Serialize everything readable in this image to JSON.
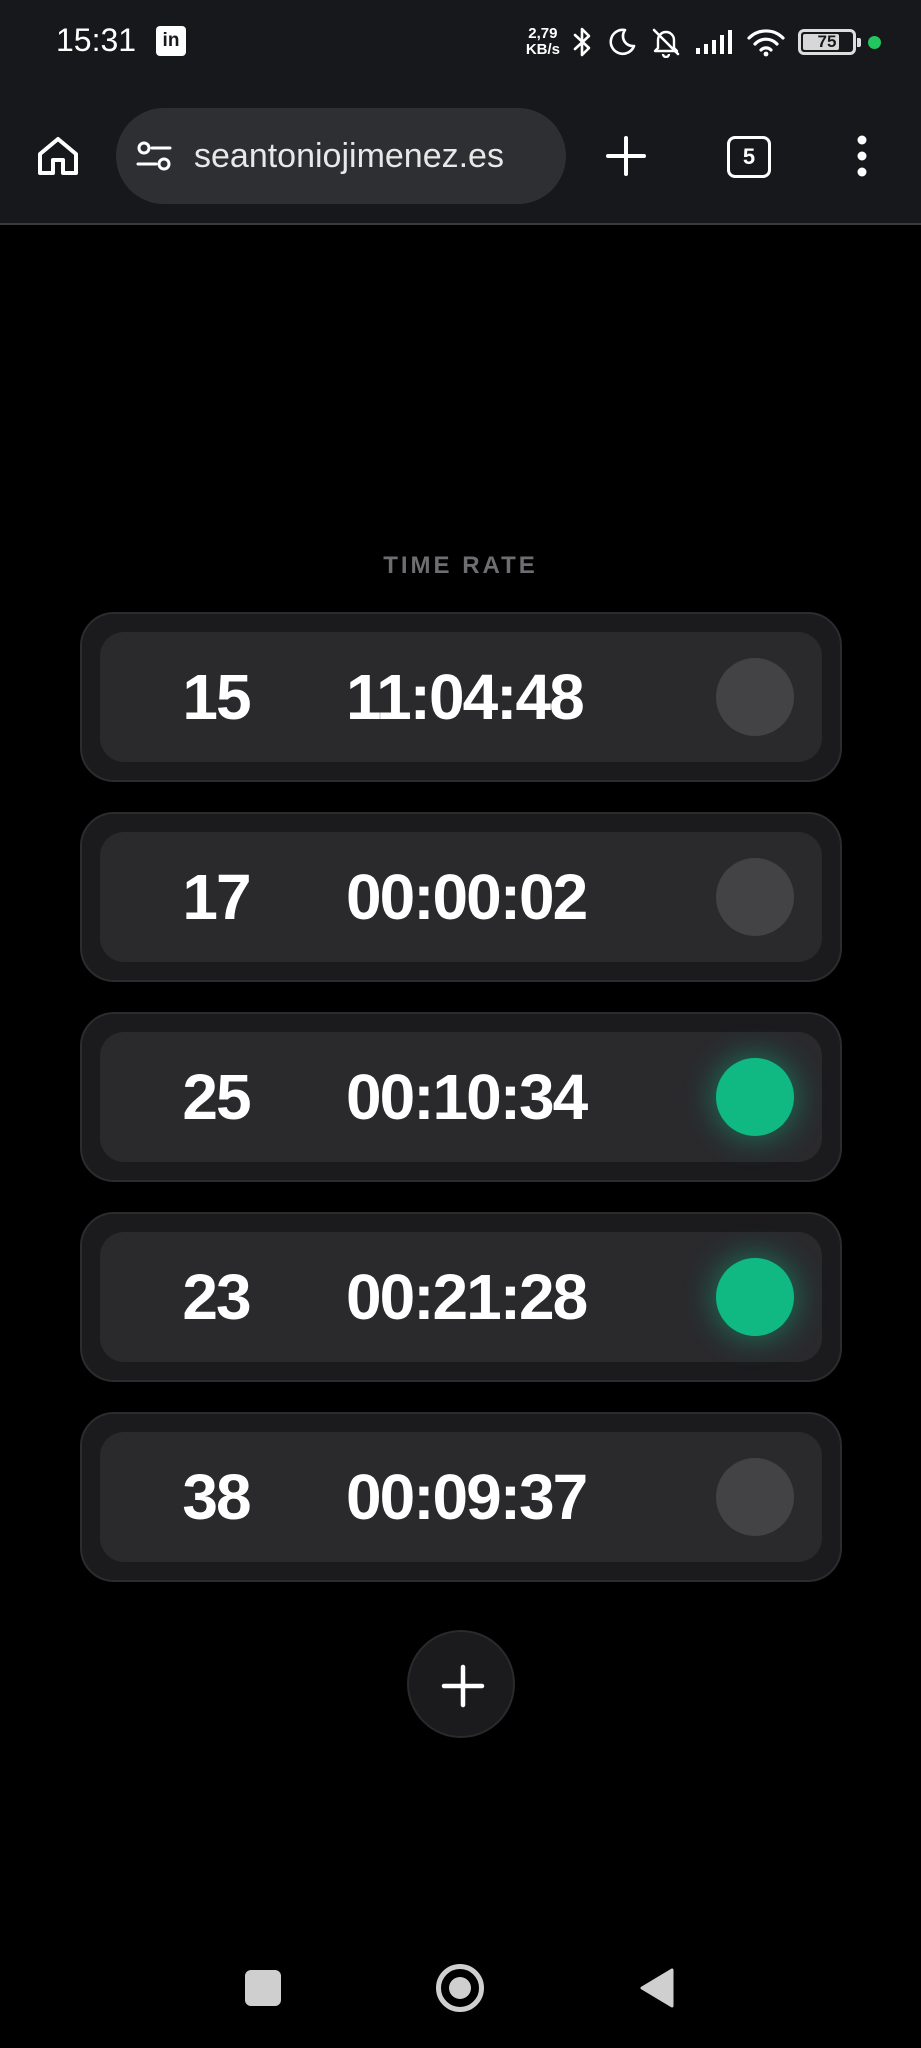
{
  "status_bar": {
    "time": "15:31",
    "app_icon_label": "in",
    "net_speed_value": "2,79",
    "net_speed_unit": "KB/s",
    "battery": "75",
    "battery_level": 0.75,
    "icons": [
      "linkedin-icon",
      "bluetooth-icon",
      "moon-icon",
      "bell-off-icon",
      "signal-icon",
      "wifi-icon",
      "battery-icon",
      "green-dot"
    ]
  },
  "browser": {
    "url": "seantoniojimenez.es",
    "tab_count": "5",
    "icons": [
      "home-icon",
      "tune-icon",
      "plus-icon",
      "tabs-icon",
      "more-vert-icon"
    ]
  },
  "app": {
    "heading": "TIME RATE",
    "timers": [
      {
        "rate": "15",
        "time": "11:04:48",
        "active": false
      },
      {
        "rate": "17",
        "time": "00:00:02",
        "active": false
      },
      {
        "rate": "25",
        "time": "00:10:34",
        "active": true
      },
      {
        "rate": "23",
        "time": "00:21:28",
        "active": true
      },
      {
        "rate": "38",
        "time": "00:09:37",
        "active": false
      }
    ],
    "active_color": "#10b981",
    "inactive_color": "#434346"
  },
  "nav_bar": {
    "icons": [
      "recents-icon",
      "home-icon",
      "back-icon"
    ]
  }
}
